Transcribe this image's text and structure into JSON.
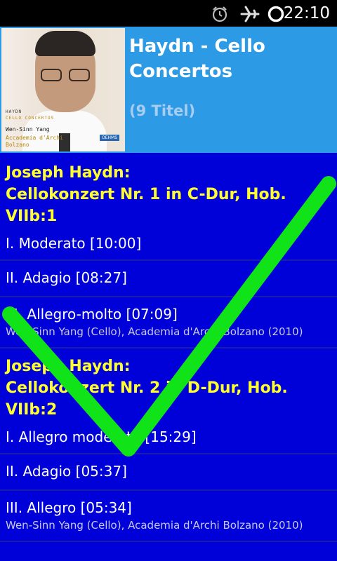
{
  "status_bar": {
    "time": "22:10",
    "icons": [
      "alarm-icon",
      "airplane-mode-icon",
      "loading-ring-icon"
    ]
  },
  "album": {
    "cover": {
      "title": "HAYDN",
      "subtitle": "CELLO CONCERTOS",
      "artist": "Wen-Sinn Yang",
      "orchestra": "Accademia d'Archi Bolzano",
      "label": "OEHMS"
    },
    "title": "Haydn - Cello Concertos",
    "track_count": "(9 Titel)"
  },
  "works": [
    {
      "title": "Joseph Haydn:\nCellokonzert Nr. 1 in C-Dur, Hob. VIIb:1",
      "tracks": [
        {
          "name": "I. Moderato [10:00]",
          "performers": ""
        },
        {
          "name": "II. Adagio [08:27]",
          "performers": ""
        },
        {
          "name": "III. Allegro-molto [07:09]",
          "performers": "Wen-Sinn Yang (Cello), Academia d'Archi Bolzano (2010)"
        }
      ]
    },
    {
      "title": "Joseph Haydn:\nCellokonzert Nr. 2 in D-Dur, Hob. VIIb:2",
      "tracks": [
        {
          "name": "I. Allegro moderato [15:29]",
          "performers": ""
        },
        {
          "name": "II. Adagio [05:37]",
          "performers": ""
        },
        {
          "name": "III. Allegro [05:34]",
          "performers": "Wen-Sinn Yang (Cello), Academia d'Archi Bolzano (2010)"
        }
      ]
    }
  ],
  "overlay": {
    "icon": "checkmark-icon",
    "color": "#10e418"
  },
  "colors": {
    "list_bg": "#0000d8",
    "header_bg": "#2d9ae6",
    "work_title": "#ffff2e",
    "divider": "#1c1cae"
  }
}
